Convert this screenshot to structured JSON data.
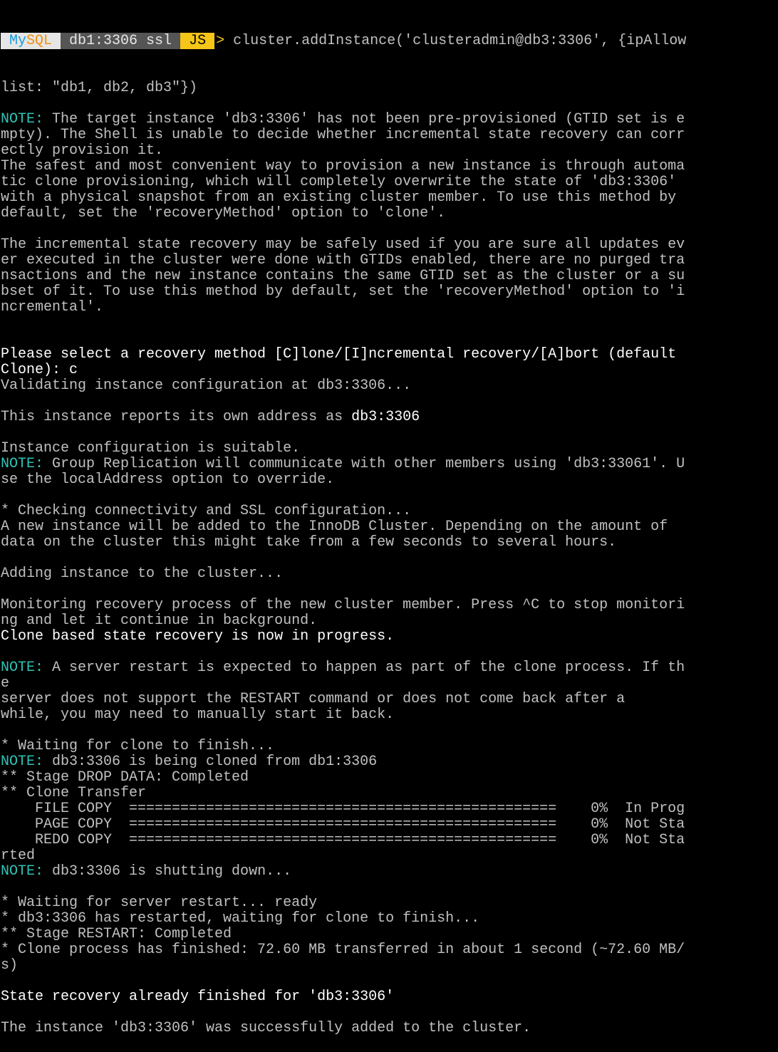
{
  "prompt": {
    "mysql_my": "My",
    "mysql_sql": "SQL",
    "host": "db1:3306 ssl",
    "mode": "JS",
    "arrow": ">",
    "command": " cluster.addInstance('clusteradmin@db3:3306', {ipAllow"
  },
  "lines": [
    [
      {
        "t": "list: \"db1, db2, db3\"})",
        "c": "normal"
      }
    ],
    [],
    [
      {
        "t": "NOTE:",
        "c": "note"
      },
      {
        "t": " The target instance 'db3:3306' has not been pre-provisioned (GTID set is e",
        "c": "normal"
      }
    ],
    [
      {
        "t": "mpty). The Shell is unable to decide whether incremental state recovery can corr",
        "c": "normal"
      }
    ],
    [
      {
        "t": "ectly provision it.",
        "c": "normal"
      }
    ],
    [
      {
        "t": "The safest and most convenient way to provision a new instance is through automa",
        "c": "normal"
      }
    ],
    [
      {
        "t": "tic clone provisioning, which will completely overwrite the state of 'db3:3306'",
        "c": "normal"
      }
    ],
    [
      {
        "t": "with a physical snapshot from an existing cluster member. To use this method by",
        "c": "normal"
      }
    ],
    [
      {
        "t": "default, set the 'recoveryMethod' option to 'clone'.",
        "c": "normal"
      }
    ],
    [],
    [
      {
        "t": "The incremental state recovery may be safely used if you are sure all updates ev",
        "c": "normal"
      }
    ],
    [
      {
        "t": "er executed in the cluster were done with GTIDs enabled, there are no purged tra",
        "c": "normal"
      }
    ],
    [
      {
        "t": "nsactions and the new instance contains the same GTID set as the cluster or a su",
        "c": "normal"
      }
    ],
    [
      {
        "t": "bset of it. To use this method by default, set the 'recoveryMethod' option to 'i",
        "c": "normal"
      }
    ],
    [
      {
        "t": "ncremental'.",
        "c": "normal"
      }
    ],
    [],
    [],
    [
      {
        "t": "Please select a recovery method [C]lone/[I]ncremental recovery/[A]bort (default",
        "c": "bright"
      }
    ],
    [
      {
        "t": "Clone): c",
        "c": "bright"
      }
    ],
    [
      {
        "t": "Validating instance configuration at db3:3306...",
        "c": "normal"
      }
    ],
    [],
    [
      {
        "t": "This instance reports its own address as ",
        "c": "normal"
      },
      {
        "t": "db3:3306",
        "c": "bright"
      }
    ],
    [],
    [
      {
        "t": "Instance configuration is suitable.",
        "c": "normal"
      }
    ],
    [
      {
        "t": "NOTE:",
        "c": "note"
      },
      {
        "t": " Group Replication will communicate with other members using 'db3:33061'. U",
        "c": "normal"
      }
    ],
    [
      {
        "t": "se the localAddress option to override.",
        "c": "normal"
      }
    ],
    [],
    [
      {
        "t": "* Checking connectivity and SSL configuration...",
        "c": "normal"
      }
    ],
    [
      {
        "t": "A new instance will be added to the InnoDB Cluster. Depending on the amount of",
        "c": "normal"
      }
    ],
    [
      {
        "t": "data on the cluster this might take from a few seconds to several hours.",
        "c": "normal"
      }
    ],
    [],
    [
      {
        "t": "Adding instance to the cluster...",
        "c": "normal"
      }
    ],
    [],
    [
      {
        "t": "Monitoring recovery process of the new cluster member. Press ^C to stop monitori",
        "c": "normal"
      }
    ],
    [
      {
        "t": "ng and let it continue in background.",
        "c": "normal"
      }
    ],
    [
      {
        "t": "Clone based state recovery is now in progress.",
        "c": "bright"
      }
    ],
    [],
    [
      {
        "t": "NOTE:",
        "c": "note"
      },
      {
        "t": " A server restart is expected to happen as part of the clone process. If th",
        "c": "normal"
      }
    ],
    [
      {
        "t": "e",
        "c": "normal"
      }
    ],
    [
      {
        "t": "server does not support the RESTART command or does not come back after a",
        "c": "normal"
      }
    ],
    [
      {
        "t": "while, you may need to manually start it back.",
        "c": "normal"
      }
    ],
    [],
    [
      {
        "t": "* Waiting for clone to finish...",
        "c": "normal"
      }
    ],
    [
      {
        "t": "NOTE:",
        "c": "note"
      },
      {
        "t": " db3:3306 is being cloned from db1:3306",
        "c": "normal"
      }
    ],
    [
      {
        "t": "** Stage DROP DATA: Completed",
        "c": "normal"
      }
    ],
    [
      {
        "t": "** Clone Transfer",
        "c": "normal"
      }
    ],
    [
      {
        "t": "    FILE COPY  ##################################################    0%  In Prog",
        "c": "normal"
      }
    ],
    [
      {
        "t": "    PAGE COPY  ##################################################    0%  Not Sta",
        "c": "normal"
      }
    ],
    [
      {
        "t": "    REDO COPY  ##################################################    0%  Not Sta",
        "c": "normal"
      }
    ],
    [
      {
        "t": "rted",
        "c": "normal"
      }
    ],
    [
      {
        "t": "NOTE:",
        "c": "note"
      },
      {
        "t": " db3:3306 is shutting down...",
        "c": "normal"
      }
    ],
    [],
    [
      {
        "t": "* Waiting for server restart... ready",
        "c": "normal"
      }
    ],
    [
      {
        "t": "* db3:3306 has restarted, waiting for clone to finish...",
        "c": "normal"
      }
    ],
    [
      {
        "t": "** Stage RESTART: Completed",
        "c": "normal"
      }
    ],
    [
      {
        "t": "* Clone process has finished: 72.60 MB transferred in about 1 second (~72.60 MB/",
        "c": "normal"
      }
    ],
    [
      {
        "t": "s)",
        "c": "normal"
      }
    ],
    [],
    [
      {
        "t": "State recovery already finished for 'db3:3306'",
        "c": "bright"
      }
    ],
    [],
    [
      {
        "t": "The instance 'db3:3306' was successfully added to the cluster.",
        "c": "normal"
      }
    ]
  ],
  "colors": {
    "background": "#000000",
    "text": "#c0c0c0",
    "note": "#2ec4b6",
    "bright": "#ffffff",
    "prompt_mysql_bg": "#e6e6e6",
    "prompt_host_bg": "#555555",
    "prompt_js_bg": "#f5c518"
  }
}
